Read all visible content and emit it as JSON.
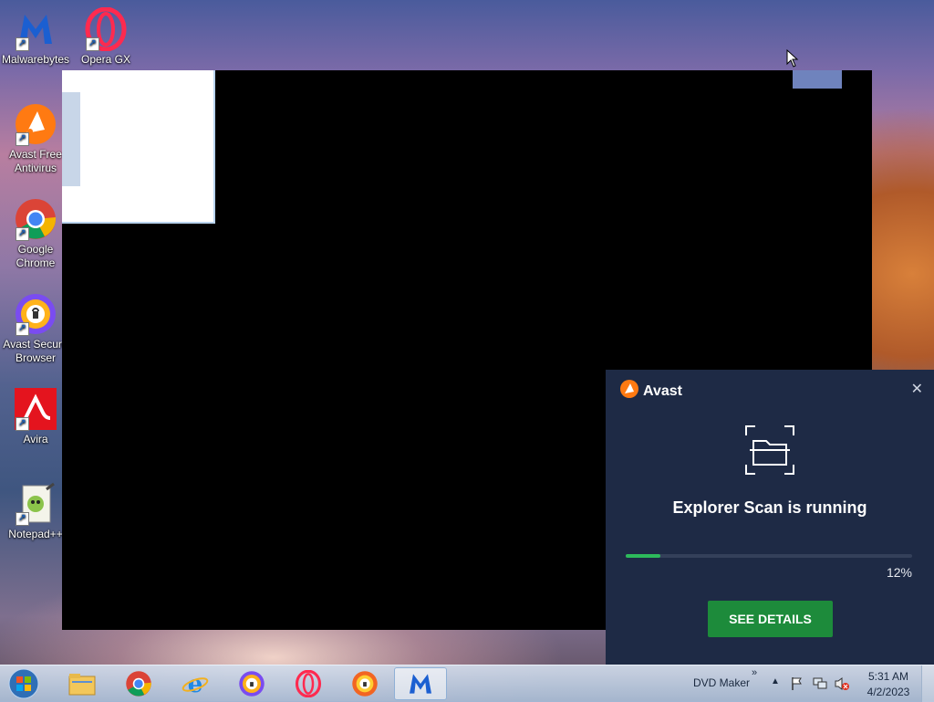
{
  "desktop": {
    "icons": [
      {
        "label": "Malwarebytes",
        "icon": "malwarebytes-icon"
      },
      {
        "label": "Opera GX",
        "icon": "opera-gx-icon"
      },
      {
        "label": "Avast Free Antivirus",
        "icon": "avast-icon"
      },
      {
        "label": "Google Chrome",
        "icon": "chrome-icon"
      },
      {
        "label": "Avast Secure Browser",
        "icon": "avast-secure-browser-icon"
      },
      {
        "label": "Avira",
        "icon": "avira-icon"
      },
      {
        "label": "Notepad++",
        "icon": "notepadpp-icon"
      }
    ]
  },
  "avast_popup": {
    "brand": "Avast",
    "title": "Explorer Scan is running",
    "progress_text": "12%",
    "progress": 0.12,
    "button_label": "SEE DETAILS",
    "accent": "#2dba5b",
    "button_color": "#1d8b3b"
  },
  "taskbar": {
    "pinned": [
      "start-icon",
      "file-explorer-icon",
      "chrome-icon",
      "internet-explorer-icon",
      "avast-secure-browser-icon",
      "opera-icon",
      "avast-browser-icon",
      "malwarebytes-icon"
    ],
    "toolbar_label": "DVD Maker",
    "time": "5:31 AM",
    "date": "4/2/2023"
  }
}
